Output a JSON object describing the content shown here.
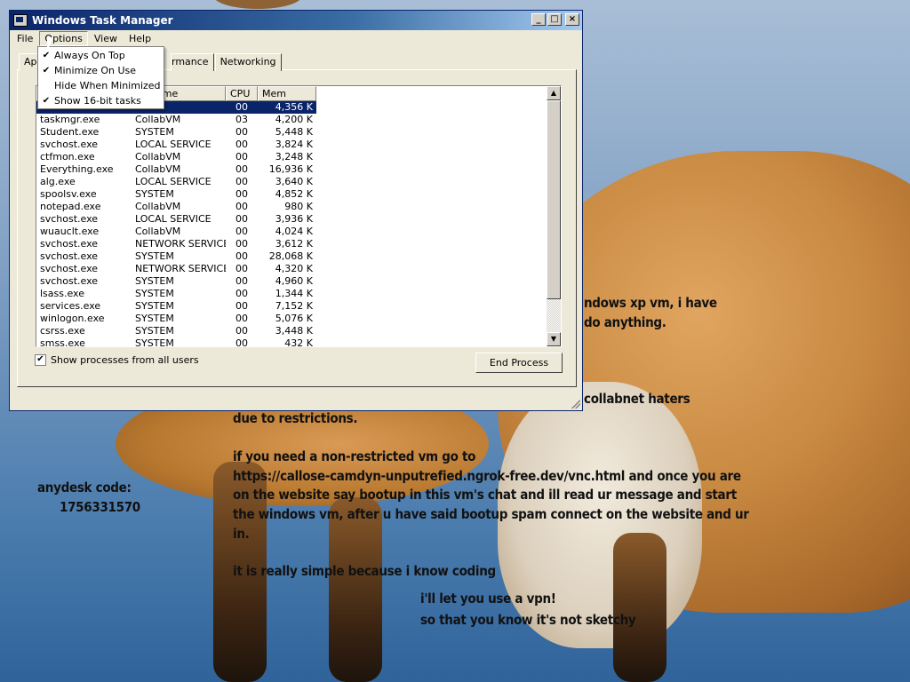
{
  "window": {
    "title": "Windows Task Manager",
    "min_glyph": "_",
    "max_glyph": "□",
    "close_glyph": "×"
  },
  "menubar": {
    "file": "File",
    "options": "Options",
    "view": "View",
    "help": "Help"
  },
  "tabs": {
    "applications": "App",
    "performance": "rmance",
    "networking": "Networking"
  },
  "options_menu": {
    "items": [
      {
        "label": "Always On Top",
        "checked": "✔"
      },
      {
        "label": "Minimize On Use",
        "checked": "✔"
      },
      {
        "label": "Hide When Minimized",
        "checked": ""
      },
      {
        "label": "Show 16-bit tasks",
        "checked": "✔"
      }
    ]
  },
  "columns": {
    "image_name": "",
    "user_name": "ame",
    "cpu": "CPU",
    "mem": "Mem Usage"
  },
  "processes": [
    {
      "name": "",
      "user": "",
      "cpu": "00",
      "mem": "4,356 K",
      "selected": true
    },
    {
      "name": "taskmgr.exe",
      "user": "CollabVM",
      "cpu": "03",
      "mem": "4,200 K"
    },
    {
      "name": "Student.exe",
      "user": "SYSTEM",
      "cpu": "00",
      "mem": "5,448 K"
    },
    {
      "name": "svchost.exe",
      "user": "LOCAL SERVICE",
      "cpu": "00",
      "mem": "3,824 K"
    },
    {
      "name": "ctfmon.exe",
      "user": "CollabVM",
      "cpu": "00",
      "mem": "3,248 K"
    },
    {
      "name": "Everything.exe",
      "user": "CollabVM",
      "cpu": "00",
      "mem": "16,936 K"
    },
    {
      "name": "alg.exe",
      "user": "LOCAL SERVICE",
      "cpu": "00",
      "mem": "3,640 K"
    },
    {
      "name": "spoolsv.exe",
      "user": "SYSTEM",
      "cpu": "00",
      "mem": "4,852 K"
    },
    {
      "name": "notepad.exe",
      "user": "CollabVM",
      "cpu": "00",
      "mem": "980 K"
    },
    {
      "name": "svchost.exe",
      "user": "LOCAL SERVICE",
      "cpu": "00",
      "mem": "3,936 K"
    },
    {
      "name": "wuauclt.exe",
      "user": "CollabVM",
      "cpu": "00",
      "mem": "4,024 K"
    },
    {
      "name": "svchost.exe",
      "user": "NETWORK SERVICE",
      "cpu": "00",
      "mem": "3,612 K"
    },
    {
      "name": "svchost.exe",
      "user": "SYSTEM",
      "cpu": "00",
      "mem": "28,068 K"
    },
    {
      "name": "svchost.exe",
      "user": "NETWORK SERVICE",
      "cpu": "00",
      "mem": "4,320 K"
    },
    {
      "name": "svchost.exe",
      "user": "SYSTEM",
      "cpu": "00",
      "mem": "4,960 K"
    },
    {
      "name": "lsass.exe",
      "user": "SYSTEM",
      "cpu": "00",
      "mem": "1,344 K"
    },
    {
      "name": "services.exe",
      "user": "SYSTEM",
      "cpu": "00",
      "mem": "7,152 K"
    },
    {
      "name": "winlogon.exe",
      "user": "SYSTEM",
      "cpu": "00",
      "mem": "5,076 K"
    },
    {
      "name": "csrss.exe",
      "user": "SYSTEM",
      "cpu": "00",
      "mem": "3,448 K"
    },
    {
      "name": "smss.exe",
      "user": "SYSTEM",
      "cpu": "00",
      "mem": "432 K"
    }
  ],
  "show_all_label": "Show processes from all users",
  "show_all_checked": "✔",
  "end_process_label": "End Process",
  "scroll_up_glyph": "▲",
  "scroll_down_glyph": "▼",
  "desktop_text": {
    "line1": "ndows xp vm, i have",
    "line2": "do anything.",
    "line3": "collabnet haters",
    "line4": "due to restrictions.",
    "line5": "if you need a non-restricted vm go to",
    "line6": "https://callose-camdyn-unputrefied.ngrok-free.dev/vnc.html and once you are",
    "line7": "on the website say bootup in this vm's chat and ill read ur message and start",
    "line8": "the windows vm, after u have said bootup spam connect on the website and ur",
    "line9": "in.",
    "line10": "it is really simple because i know coding",
    "line11": "i'll let you use a vpn!",
    "line12": "so that you know it's not sketchy",
    "anydesk_label": "anydesk code:",
    "anydesk_code": "1756331570"
  }
}
